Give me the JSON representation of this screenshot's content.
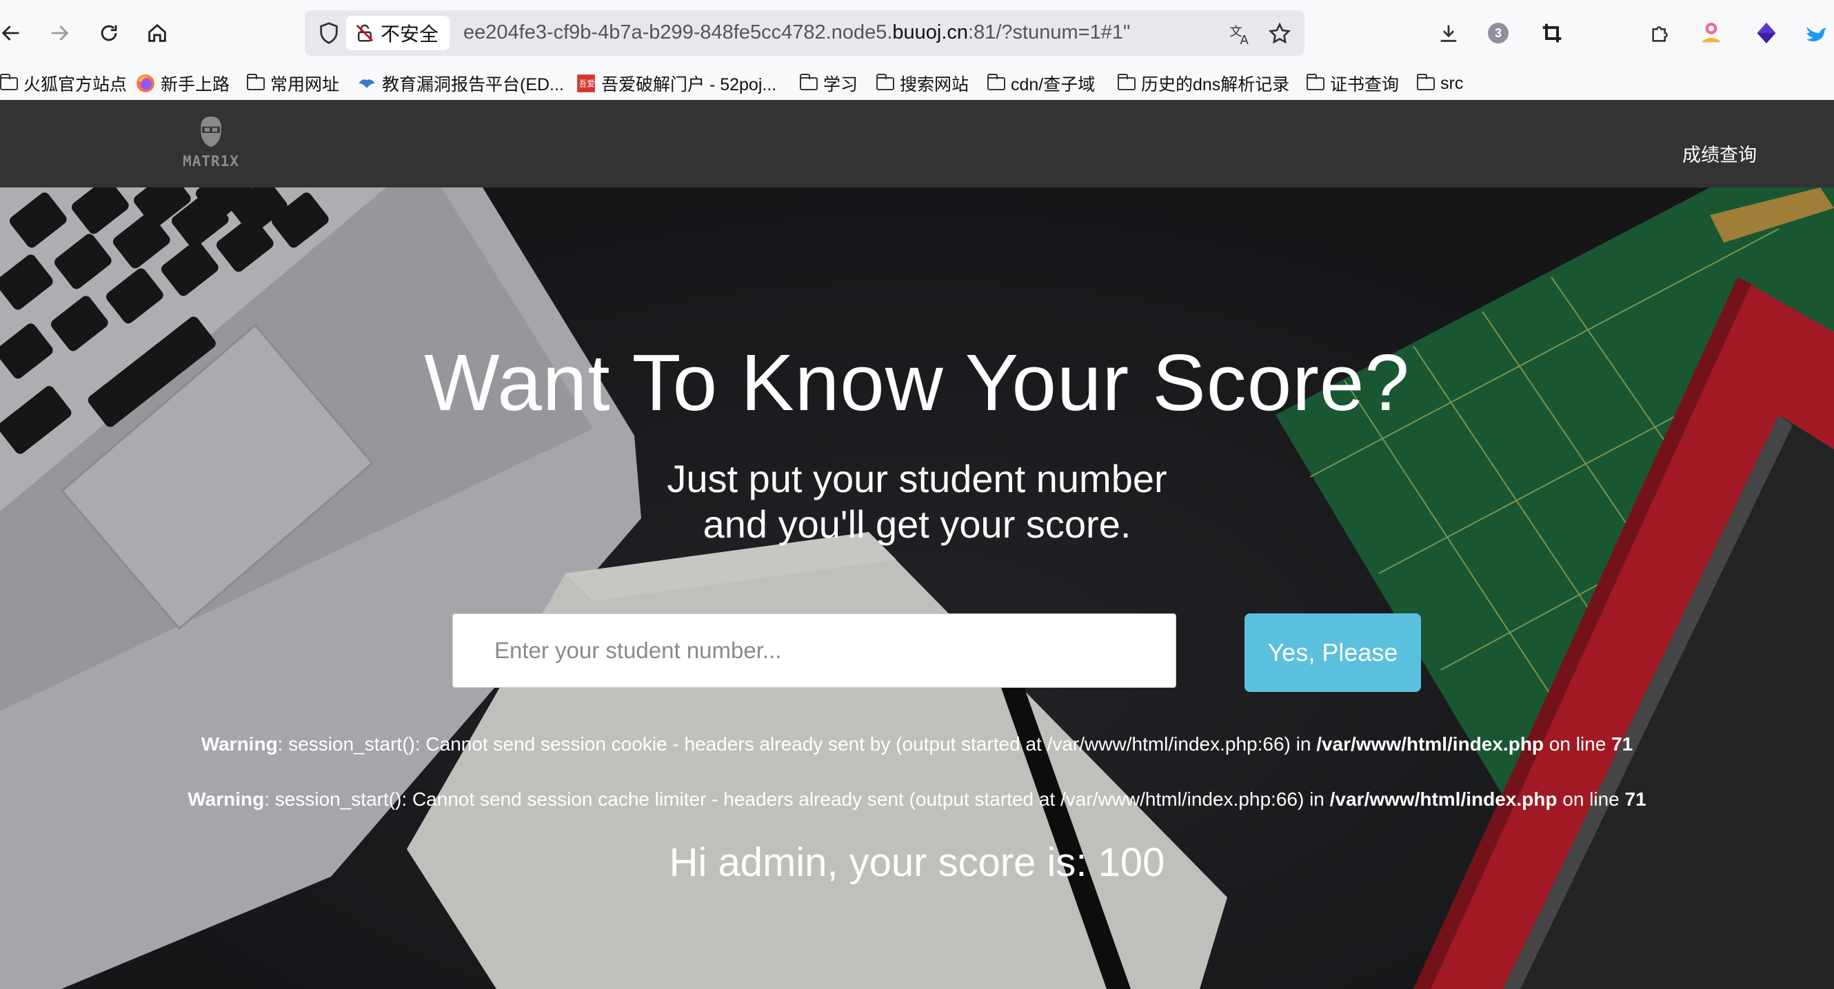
{
  "browser": {
    "security_label": "不安全",
    "url_prefix": "ee204fe3-cf9b-4b7a-b299-848fe5cc4782.node5.",
    "url_domain": "buuoj.cn",
    "url_suffix": ":81/?stunum=1#1\"",
    "extension_badge_count": "3"
  },
  "bookmarks": [
    {
      "label": "火狐官方站点",
      "icon": "folder-icon"
    },
    {
      "label": "新手上路",
      "icon": "firefox-icon"
    },
    {
      "label": "常用网址",
      "icon": "folder-icon"
    },
    {
      "label": "教育漏洞报告平台(ED...",
      "icon": "edu-icon"
    },
    {
      "label": "吾爱破解门户 - 52poj...",
      "icon": "52pojie-icon"
    },
    {
      "label": "学习",
      "icon": "folder-icon"
    },
    {
      "label": "搜索网站",
      "icon": "folder-icon"
    },
    {
      "label": "cdn/查子域",
      "icon": "folder-icon"
    },
    {
      "label": "历史的dns解析记录",
      "icon": "folder-icon"
    },
    {
      "label": "证书查询",
      "icon": "folder-icon"
    },
    {
      "label": "src",
      "icon": "folder-icon"
    }
  ],
  "site": {
    "logo_text": "MATR1X",
    "nav_link": "成绩查询"
  },
  "hero": {
    "heading": "Want To Know Your Score?",
    "sub_line1": "Just put your student number",
    "sub_line2": "and you'll get your score.",
    "input_placeholder": "Enter your student number...",
    "button_label": "Yes, Please"
  },
  "warnings": [
    {
      "label": "Warning",
      "message": ": session_start(): Cannot send session cookie - headers already sent by (output started at /var/www/html/index.php:66) in ",
      "file": "/var/www/html/index.php",
      "on_line": " on line ",
      "line": "71"
    },
    {
      "label": "Warning",
      "message": ": session_start(): Cannot send session cache limiter - headers already sent (output started at /var/www/html/index.php:66) in ",
      "file": "/var/www/html/index.php",
      "on_line": " on line ",
      "line": "71"
    }
  ],
  "result": {
    "message": "Hi admin, your score is: 100"
  },
  "colors": {
    "nav_bg": "#333333",
    "button_bg": "#5bc0de"
  }
}
